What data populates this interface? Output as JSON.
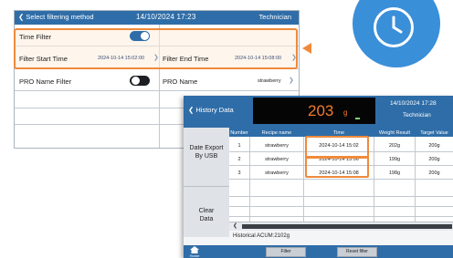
{
  "filter_screen": {
    "header": {
      "back_label": "Select filtering method",
      "datetime": "14/10/2024 17:23",
      "role": "Technician"
    },
    "time_filter": {
      "label": "Time Filter",
      "enabled": true
    },
    "filter_start_time": {
      "label": "Filter Start Time",
      "value": "2024-10-14 15:02:00"
    },
    "filter_end_time": {
      "label": "Filter End Time",
      "value": "2024-10-14 15:08:00"
    },
    "pro_name_filter": {
      "label": "PRO Name Filter",
      "enabled": false
    },
    "pro_name": {
      "label": "PRO Name",
      "value": "strawberry"
    }
  },
  "history_screen": {
    "header": {
      "back_label": "History Data",
      "weight_value": "203",
      "weight_unit": "g",
      "datetime": "14/10/2024 17:28",
      "role": "Technician"
    },
    "sidebar": {
      "date_export_line1": "Date Export",
      "date_export_line2": "By USB",
      "clear_line1": "Clear",
      "clear_line2": "Data"
    },
    "table": {
      "columns": [
        "Number",
        "Recipe name",
        "Time",
        "Weight Result",
        "Target Value"
      ],
      "rows": [
        {
          "number": "1",
          "recipe": "strawberry",
          "time": "2024-10-14 15:02",
          "weight": "202g",
          "target": "200g"
        },
        {
          "number": "2",
          "recipe": "strawberry",
          "time": "2024-10-14 15:06",
          "weight": "199g",
          "target": "200g"
        },
        {
          "number": "3",
          "recipe": "strawberry",
          "time": "2024-10-14 15:08",
          "weight": "198g",
          "target": "200g"
        }
      ]
    },
    "accumulation": "Historical ACUM:2102g",
    "footer": {
      "home_label": "Home",
      "filter_label": "Filter",
      "reset_label": "Reset filter"
    }
  },
  "colors": {
    "header_blue": "#2f6da8",
    "highlight_orange": "#ef8a3c",
    "clock_blue": "#3a8fd9",
    "weight_orange": "#f07b2e"
  },
  "icons": [
    "chevron-left-icon",
    "clock-icon",
    "home-icon",
    "toggle-switch"
  ]
}
